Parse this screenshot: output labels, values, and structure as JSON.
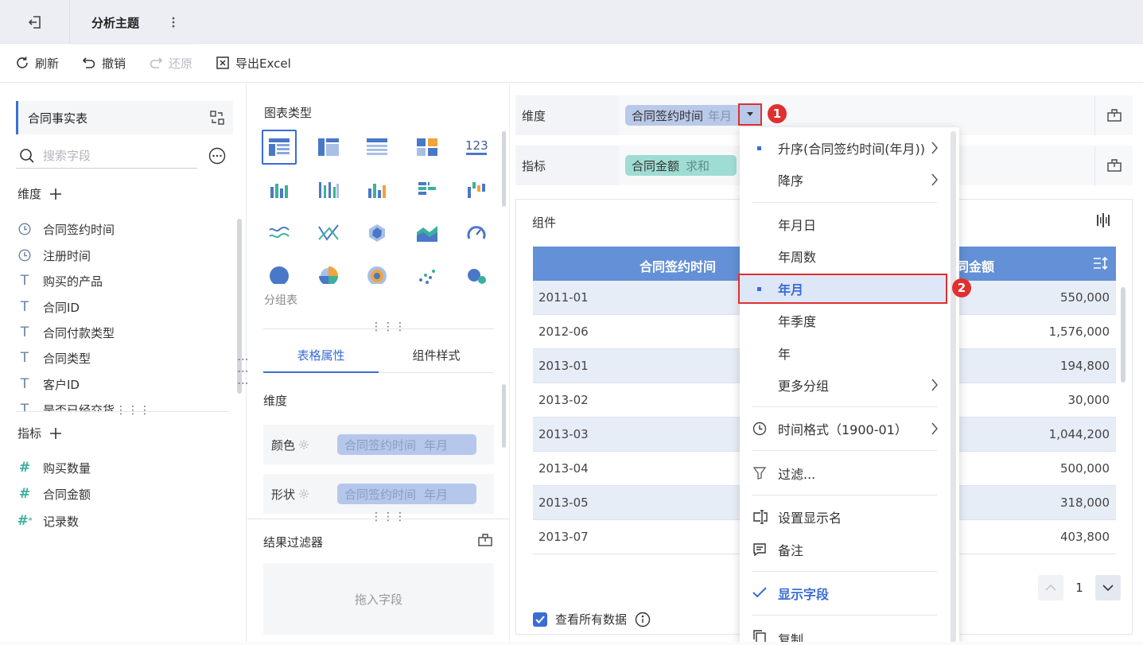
{
  "app": {
    "tab_title": "分析主题"
  },
  "toolbar": {
    "refresh": "刷新",
    "undo": "撤销",
    "redo": "还原",
    "export": "导出Excel"
  },
  "left": {
    "dataset": "合同事实表",
    "search_placeholder": "搜索字段",
    "dimension_header": "维度",
    "dimensions": [
      {
        "label": "合同签约时间",
        "icon": "clock-icon"
      },
      {
        "label": "注册时间",
        "icon": "clock-icon"
      },
      {
        "label": "购买的产品",
        "icon": "text-field-icon"
      },
      {
        "label": "合同ID",
        "icon": "text-field-icon"
      },
      {
        "label": "合同付款类型",
        "icon": "text-field-icon"
      },
      {
        "label": "合同类型",
        "icon": "text-field-icon"
      },
      {
        "label": "客户ID",
        "icon": "text-field-icon"
      },
      {
        "label": "是否已经交货",
        "icon": "text-field-icon"
      }
    ],
    "measure_header": "指标",
    "measures": [
      {
        "label": "购买数量",
        "icon": "number-field-icon"
      },
      {
        "label": "合同金额",
        "icon": "number-field-icon"
      },
      {
        "label": "记录数",
        "icon": "record-count-icon"
      }
    ]
  },
  "middle": {
    "chart_type_title": "图表类型",
    "chart_type_caption": "分组表",
    "tabs": [
      "表格属性",
      "组件样式"
    ],
    "dim_label": "维度",
    "props": [
      {
        "label": "颜色",
        "chip_field": "合同签约时间",
        "chip_sub": "年月"
      },
      {
        "label": "形状",
        "chip_field": "合同签约时间",
        "chip_sub": "年月"
      }
    ],
    "filter_title": "结果过滤器",
    "drop_hint": "拖入字段"
  },
  "shelves": {
    "dimension_label": "维度",
    "dimension_chip": "合同签约时间",
    "dimension_chip_sub": "年月",
    "measure_label": "指标",
    "measure_chip": "合同金额",
    "measure_chip_sub": "求和"
  },
  "markers": [
    "1",
    "2"
  ],
  "component": {
    "title": "组件",
    "col1": "合同签约时间",
    "col2": "合同金额",
    "rows": [
      {
        "date": "2011-01",
        "amount": "550,000"
      },
      {
        "date": "2012-06",
        "amount": "1,576,000"
      },
      {
        "date": "2013-01",
        "amount": "194,800"
      },
      {
        "date": "2013-02",
        "amount": "30,000"
      },
      {
        "date": "2013-03",
        "amount": "1,044,200"
      },
      {
        "date": "2013-04",
        "amount": "500,000"
      },
      {
        "date": "2013-05",
        "amount": "318,000"
      },
      {
        "date": "2013-07",
        "amount": "403,800"
      }
    ],
    "page": "1",
    "view_all": "查看所有数据"
  },
  "menu": {
    "sort_asc": "升序(合同签约时间(年月))",
    "sort_desc": "降序",
    "ymd": "年月日",
    "year_week": "年周数",
    "year_month": "年月",
    "year_quarter": "年季度",
    "year": "年",
    "more_groups": "更多分组",
    "time_format": "时间格式（1900-01）",
    "filter": "过滤...",
    "display_name": "设置显示名",
    "note": "备注",
    "show_field": "显示字段",
    "copy": "复制"
  },
  "colors": {
    "accent": "#3b6cd6",
    "header": "#6390d6",
    "marker": "#e0302f",
    "dim_chip": "#b9c9ea",
    "measure_chip": "#9fdcd3"
  }
}
